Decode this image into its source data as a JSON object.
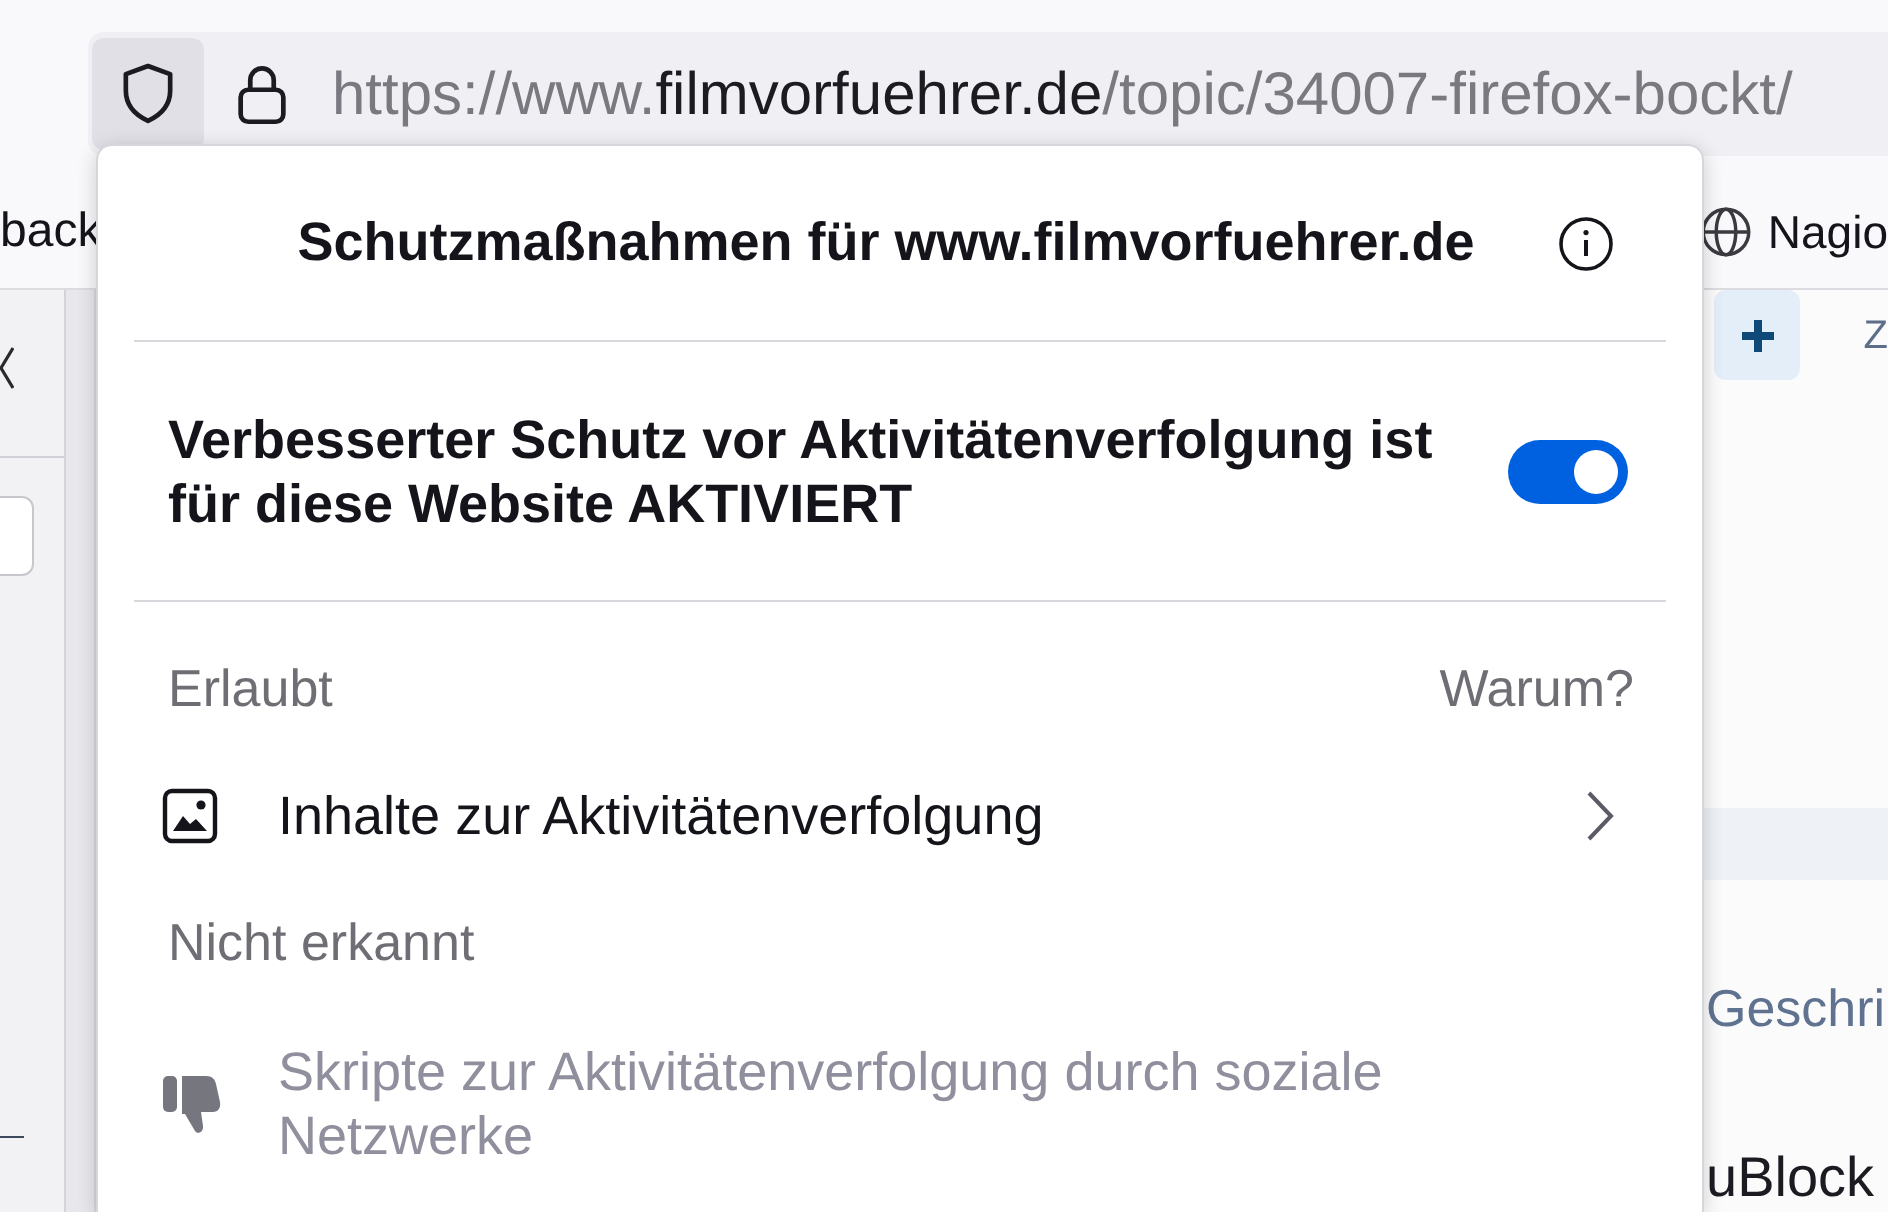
{
  "toolbar": {
    "url": {
      "scheme": "https://www.",
      "host": "filmvorfuehrer.de",
      "path": "/topic/34007-firefox-bockt/"
    }
  },
  "bookmarks": [
    {
      "kind": "plain",
      "label": "back"
    },
    {
      "kind": "site",
      "label": "Nagio"
    }
  ],
  "page": {
    "right_column": {
      "tab_fragment": "Z",
      "link_fragment": "Geschri",
      "text_fragment": "uBlock"
    }
  },
  "panel": {
    "title": "Schutzmaßnahmen für www.filmvorfuehrer.de",
    "protection": {
      "label": "Verbesserter Schutz vor Aktivitätenverfolgung ist für diese Website AKTIVIERT",
      "on": true
    },
    "sections": [
      {
        "heading": "Erlaubt",
        "link": "Warum?",
        "items": [
          {
            "kind": "content",
            "label": "Inhalte zur Aktivitätenverfolgung",
            "disabled": false
          }
        ]
      },
      {
        "heading": "Nicht erkannt",
        "items": [
          {
            "kind": "social",
            "label": "Skripte zur Aktivitätenverfolgung durch soziale Netzwerke",
            "disabled": true
          }
        ]
      }
    ]
  }
}
